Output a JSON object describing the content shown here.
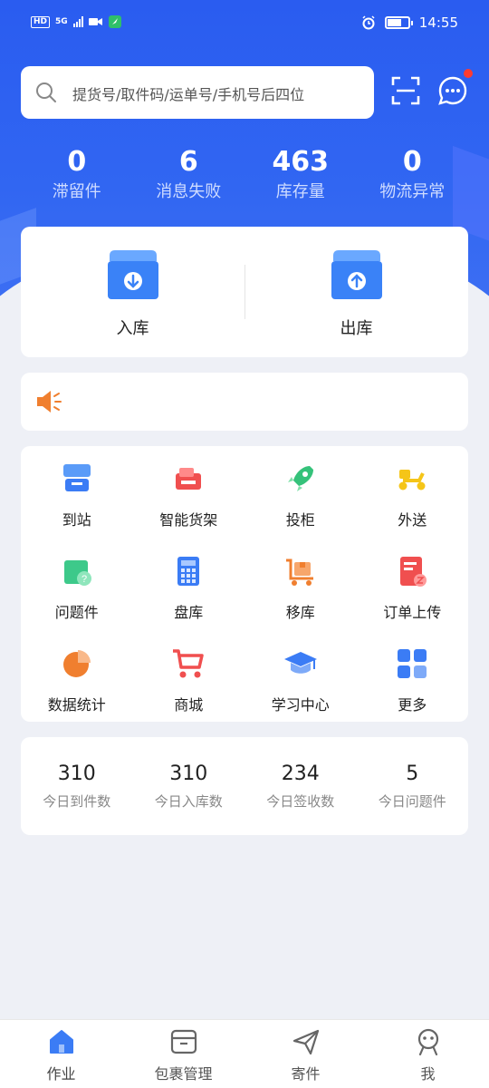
{
  "status_bar": {
    "time": "14:55",
    "network": "5G",
    "hd": "HD"
  },
  "search": {
    "placeholder": "提货号/取件码/运单号/手机号后四位"
  },
  "stats": [
    {
      "value": "0",
      "label": "滞留件"
    },
    {
      "value": "6",
      "label": "消息失败"
    },
    {
      "value": "463",
      "label": "库存量"
    },
    {
      "value": "0",
      "label": "物流异常"
    }
  ],
  "io": {
    "in_label": "入库",
    "out_label": "出库"
  },
  "grid": [
    {
      "label": "到站",
      "icon": "station-icon",
      "color": "#3b7cf5"
    },
    {
      "label": "智能货架",
      "icon": "shelf-icon",
      "color": "#f04f4f"
    },
    {
      "label": "投柜",
      "icon": "rocket-icon",
      "color": "#35c27a"
    },
    {
      "label": "外送",
      "icon": "scooter-icon",
      "color": "#f5c518"
    },
    {
      "label": "问题件",
      "icon": "problem-package-icon",
      "color": "#3dc98a"
    },
    {
      "label": "盘库",
      "icon": "calculator-icon",
      "color": "#3b7cf5"
    },
    {
      "label": "移库",
      "icon": "cart-box-icon",
      "color": "#f07f2f"
    },
    {
      "label": "订单上传",
      "icon": "order-upload-icon",
      "color": "#f04f4f"
    },
    {
      "label": "数据统计",
      "icon": "pie-chart-icon",
      "color": "#f07f2f"
    },
    {
      "label": "商城",
      "icon": "shopping-cart-icon",
      "color": "#f04f4f"
    },
    {
      "label": "学习中心",
      "icon": "graduation-cap-icon",
      "color": "#3b7cf5"
    },
    {
      "label": "更多",
      "icon": "more-grid-icon",
      "color": "#3b7cf5"
    }
  ],
  "today": [
    {
      "value": "310",
      "label": "今日到件数"
    },
    {
      "value": "310",
      "label": "今日入库数"
    },
    {
      "value": "234",
      "label": "今日签收数"
    },
    {
      "value": "5",
      "label": "今日问题件"
    }
  ],
  "tabs": [
    {
      "label": "作业",
      "icon": "home-icon",
      "active": true
    },
    {
      "label": "包裹管理",
      "icon": "package-manage-icon",
      "active": false
    },
    {
      "label": "寄件",
      "icon": "send-icon",
      "active": false
    },
    {
      "label": "我",
      "icon": "profile-icon",
      "active": false
    }
  ],
  "colors": {
    "brand_blue": "#2a5cf0",
    "badge_red": "#ff3b30",
    "notice_orange": "#f07f2f"
  }
}
